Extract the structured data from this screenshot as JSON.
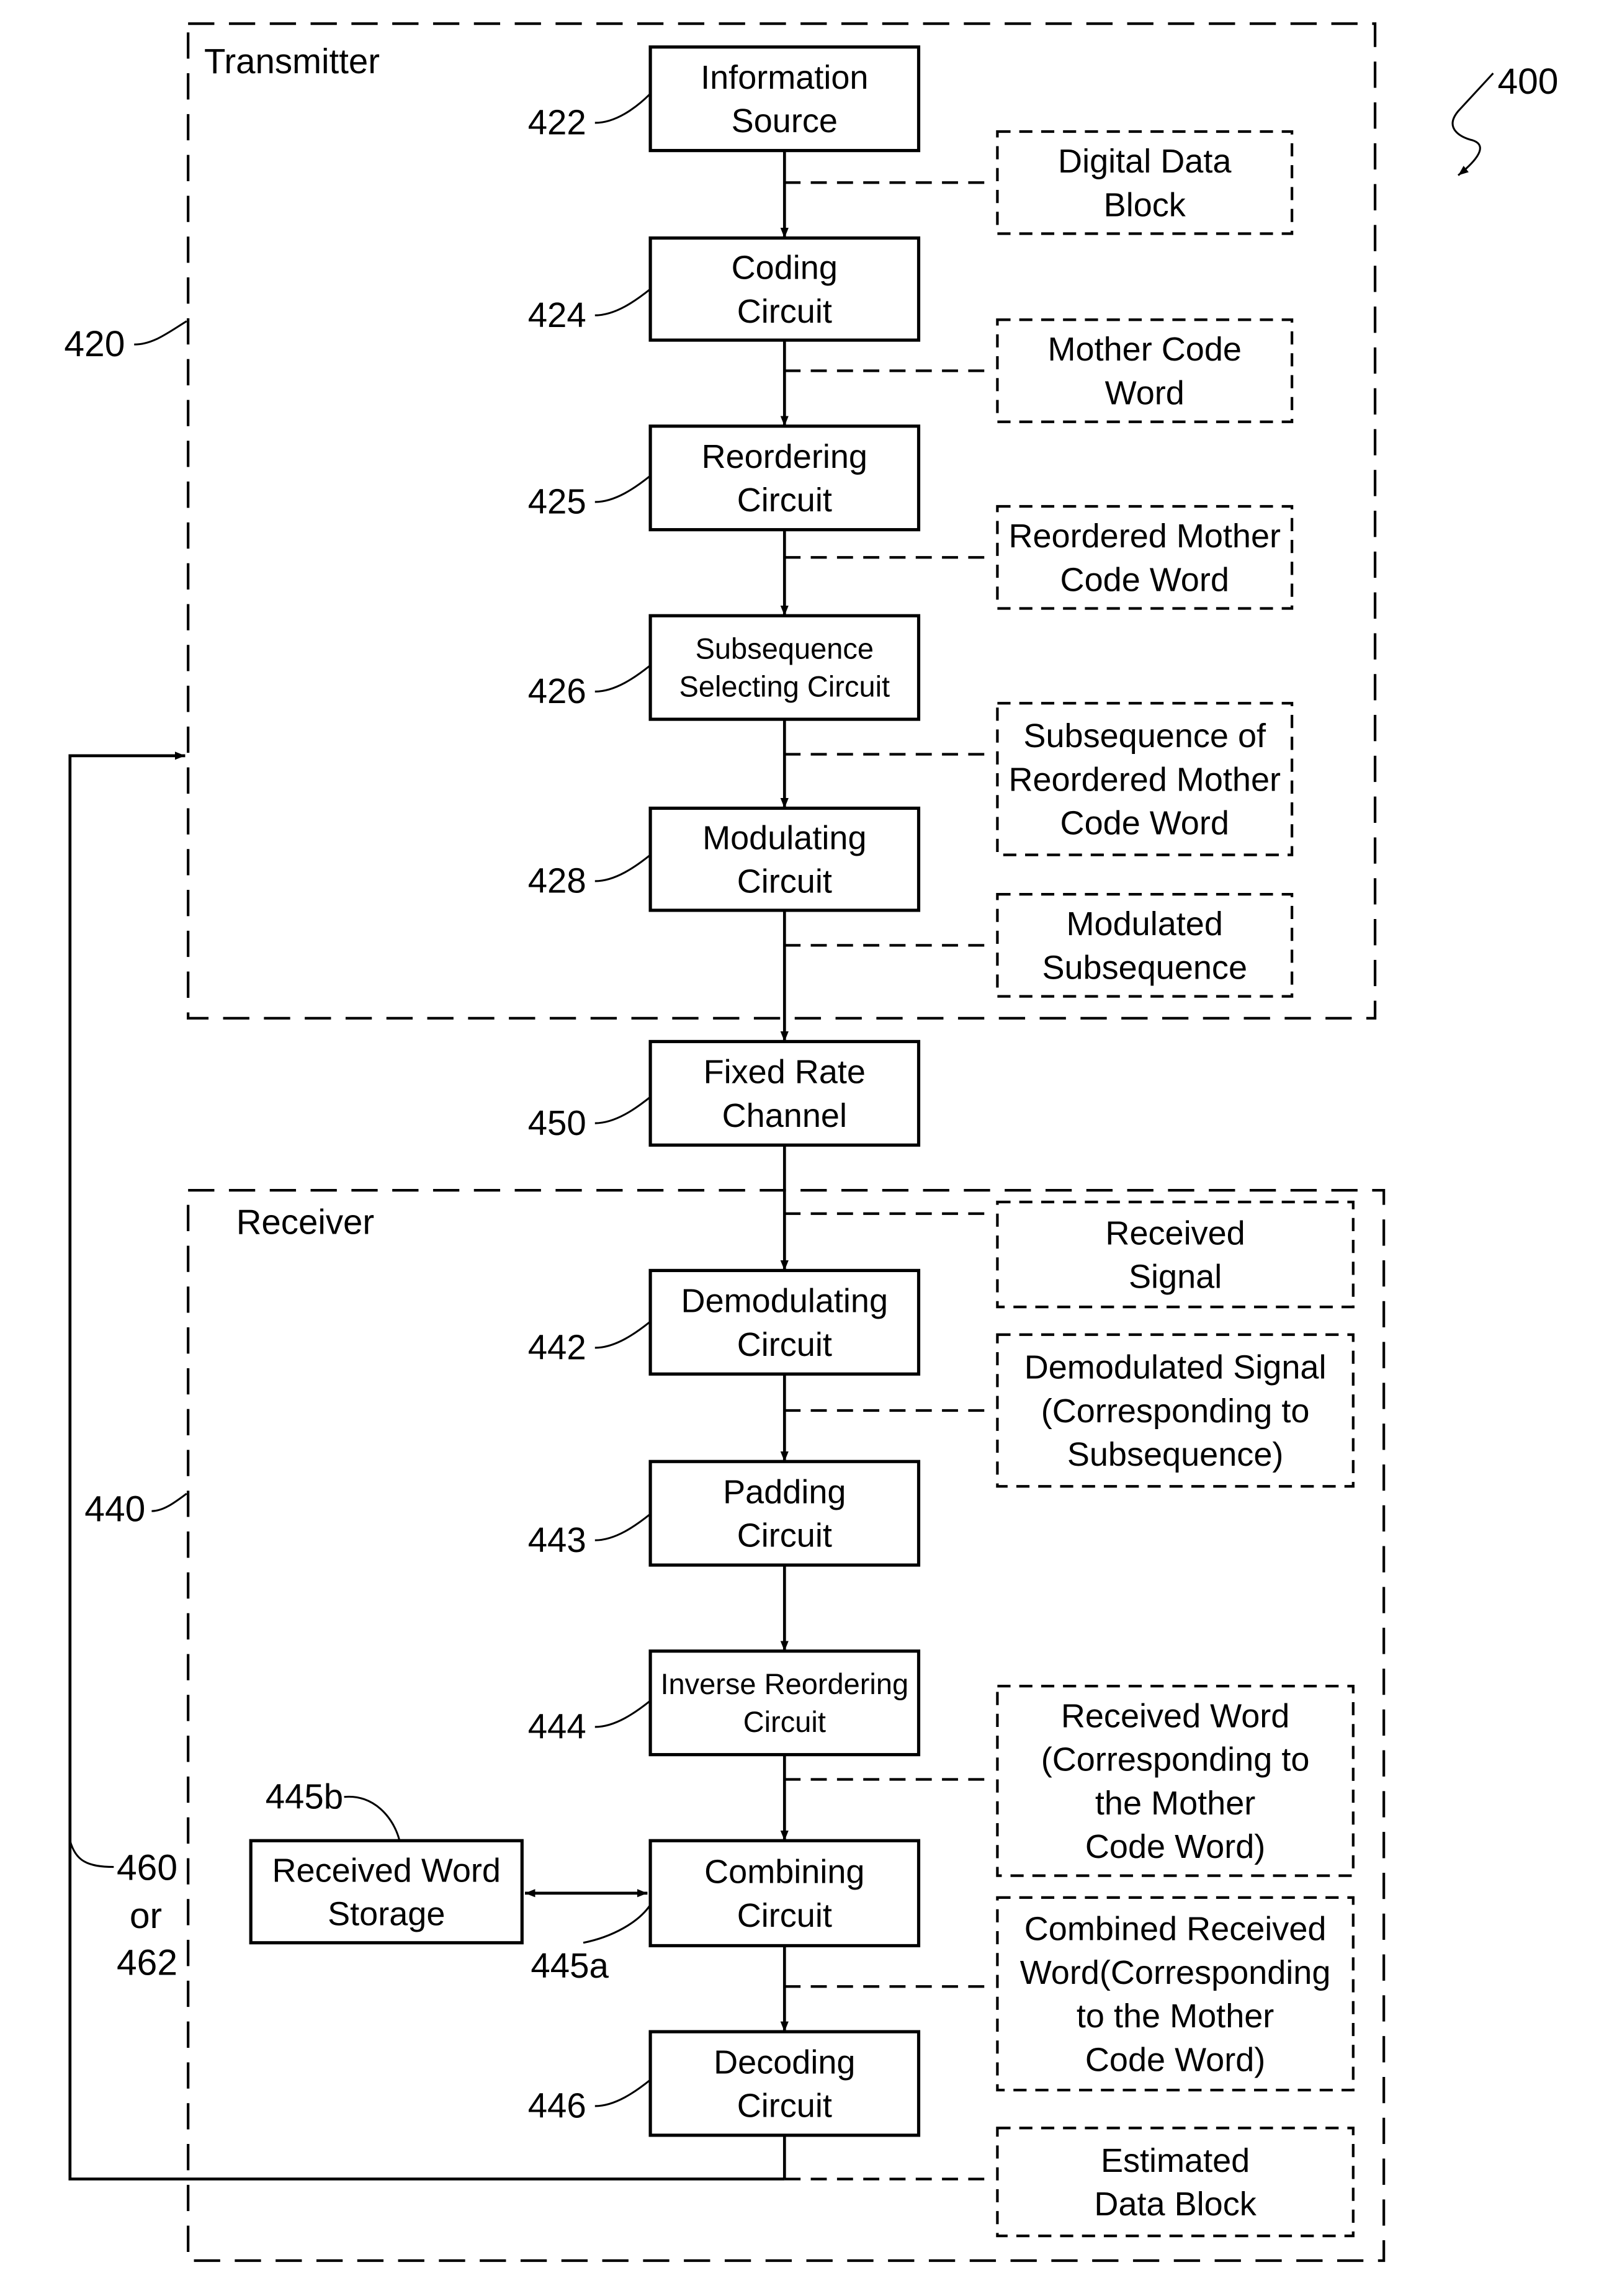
{
  "figure_ref": "400",
  "regions": {
    "transmitter": {
      "label": "Transmitter",
      "ref": "420"
    },
    "receiver": {
      "label": "Receiver",
      "ref": "440"
    }
  },
  "blocks": [
    {
      "id": "information-source",
      "ref": "422",
      "lines": [
        "Information",
        "Source"
      ]
    },
    {
      "id": "coding-circuit",
      "ref": "424",
      "lines": [
        "Coding",
        "Circuit"
      ]
    },
    {
      "id": "reordering-circuit",
      "ref": "425",
      "lines": [
        "Reordering",
        "Circuit"
      ]
    },
    {
      "id": "subsequence-selecting-circuit",
      "ref": "426",
      "lines": [
        "Subsequence",
        "Selecting Circuit"
      ]
    },
    {
      "id": "modulating-circuit",
      "ref": "428",
      "lines": [
        "Modulating",
        "Circuit"
      ]
    },
    {
      "id": "fixed-rate-channel",
      "ref": "450",
      "lines": [
        "Fixed Rate",
        "Channel"
      ]
    },
    {
      "id": "demodulating-circuit",
      "ref": "442",
      "lines": [
        "Demodulating",
        "Circuit"
      ]
    },
    {
      "id": "padding-circuit",
      "ref": "443",
      "lines": [
        "Padding",
        "Circuit"
      ]
    },
    {
      "id": "inverse-reordering-circuit",
      "ref": "444",
      "lines": [
        "Inverse Reordering",
        "Circuit"
      ]
    },
    {
      "id": "combining-circuit",
      "ref": "445a",
      "lines": [
        "Combining",
        "Circuit"
      ]
    },
    {
      "id": "decoding-circuit",
      "ref": "446",
      "lines": [
        "Decoding",
        "Circuit"
      ]
    },
    {
      "id": "received-word-storage",
      "ref": "445b",
      "lines": [
        "Received Word",
        "Storage"
      ]
    }
  ],
  "signals": [
    {
      "id": "digital-data-block",
      "lines": [
        "Digital Data",
        "Block"
      ]
    },
    {
      "id": "mother-code-word",
      "lines": [
        "Mother Code",
        "Word"
      ]
    },
    {
      "id": "reordered-mother-code-word",
      "lines": [
        "Reordered Mother",
        "Code Word"
      ]
    },
    {
      "id": "subsequence-of-reordered",
      "lines": [
        "Subsequence of",
        "Reordered Mother",
        "Code Word"
      ]
    },
    {
      "id": "modulated-subsequence",
      "lines": [
        "Modulated",
        "Subsequence"
      ]
    },
    {
      "id": "received-signal",
      "lines": [
        "Received",
        "Signal"
      ]
    },
    {
      "id": "demodulated-signal",
      "lines": [
        "Demodulated Signal",
        "(Corresponding to",
        "Subsequence)"
      ]
    },
    {
      "id": "received-word",
      "lines": [
        "Received Word",
        "(Corresponding to",
        "the Mother",
        "Code Word)"
      ]
    },
    {
      "id": "combined-received-word",
      "lines": [
        "Combined Received",
        "Word(Corresponding",
        "to the Mother",
        "Code Word)"
      ]
    },
    {
      "id": "estimated-data-block",
      "lines": [
        "Estimated",
        "Data Block"
      ]
    }
  ],
  "feedback": {
    "ref_lines": [
      "460",
      "or",
      "462"
    ]
  }
}
